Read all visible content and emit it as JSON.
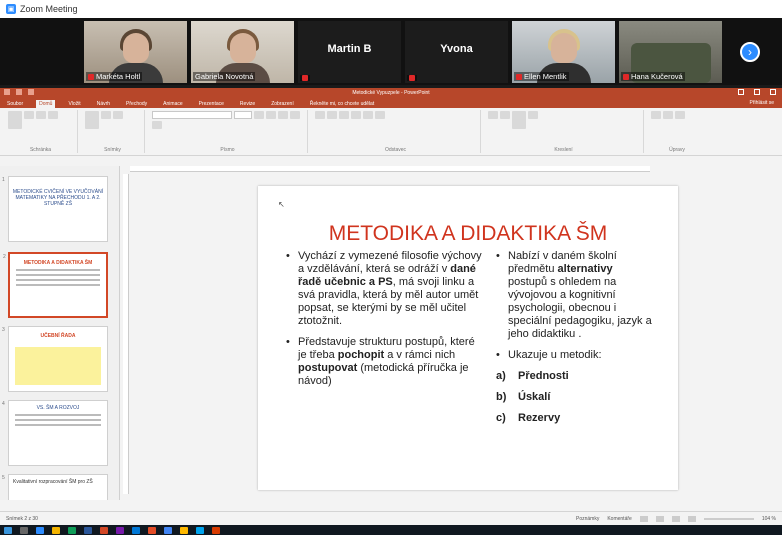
{
  "zoom": {
    "window_title": "Zoom Meeting",
    "participants": [
      {
        "name": "Markéta Holtl",
        "type": "video"
      },
      {
        "name": "Gabriela Novotná",
        "type": "video"
      },
      {
        "name": "Martin B",
        "type": "name"
      },
      {
        "name": "Yvona",
        "type": "name"
      },
      {
        "name": "Ellen Mentlik",
        "type": "video"
      },
      {
        "name": "Hana Kučerová",
        "type": "video"
      }
    ]
  },
  "ppt": {
    "window_title": "Metodické Vypuzpele - PowerPoint",
    "tabs": [
      "Soubor",
      "Domů",
      "Vložit",
      "Návrh",
      "Přechody",
      "Animace",
      "Prezentace",
      "Revize",
      "Zobrazení",
      "Řekněte mi, co chcete udělat"
    ],
    "share": "Přihlásit se",
    "ribbon_groups": [
      "Schránka",
      "Snímky",
      "Písmo",
      "Odstavec",
      "Kreslení",
      "Úpravy"
    ]
  },
  "thumbnails": [
    {
      "num": "1",
      "title": "METODICKÉ CVIČENÍ VE VYUČOVÁNÍ MATEMATIKY NA PŘECHODU 1. A 2. STUPNĚ ZŠ"
    },
    {
      "num": "2",
      "title": "METODIKA A DIDAKTIKA ŠM"
    },
    {
      "num": "3",
      "title": "UČEBNÍ ŘADA"
    },
    {
      "num": "4",
      "title": "VS. ŠM A ROZVOJ"
    },
    {
      "num": "5",
      "title": "Kvalitativní rozpracování ŠM pro ZŠ"
    }
  ],
  "slide": {
    "title": "METODIKA A DIDAKTIKA ŠM",
    "left_bullets": [
      {
        "pre": "Vychází z vymezené filosofie výchovy a vzdělávání, která se odráží v ",
        "bold": "dané řadě učebnic a PS",
        "post": ", má svoji linku a svá pravidla, která by měl autor umět popsat, se kterými by se měl učitel ztotožnit."
      },
      {
        "pre": "Představuje strukturu postupů, které je třeba ",
        "bold": "pochopit",
        "mid": " a v rámci nich ",
        "bold2": "postupovat",
        "post": " (metodická příručka je návod)"
      }
    ],
    "right_bullets": [
      {
        "pre": "Nabízí v daném školní předmětu ",
        "bold": "alternativy",
        "post": " postupů s ohledem na vývojovou a kognitivní psychologii, obecnou i speciální pedagogiku, jazyk a jeho didaktiku ."
      },
      {
        "pre": "Ukazuje u metodik:",
        "bold": "",
        "post": ""
      }
    ],
    "numbered": [
      {
        "n": "a)",
        "text": "Přednosti"
      },
      {
        "n": "b)",
        "text": "Úskalí"
      },
      {
        "n": "c)",
        "text": "Rezervy"
      }
    ]
  },
  "status": {
    "slide_info": "Snímek 2 z 30",
    "notes": "Poznámky",
    "comments": "Komentáře",
    "zoom": "104 %"
  },
  "colors": {
    "ppt_accent": "#b7472a",
    "slide_title": "#d0341e",
    "zoom_blue": "#2d8cff"
  }
}
